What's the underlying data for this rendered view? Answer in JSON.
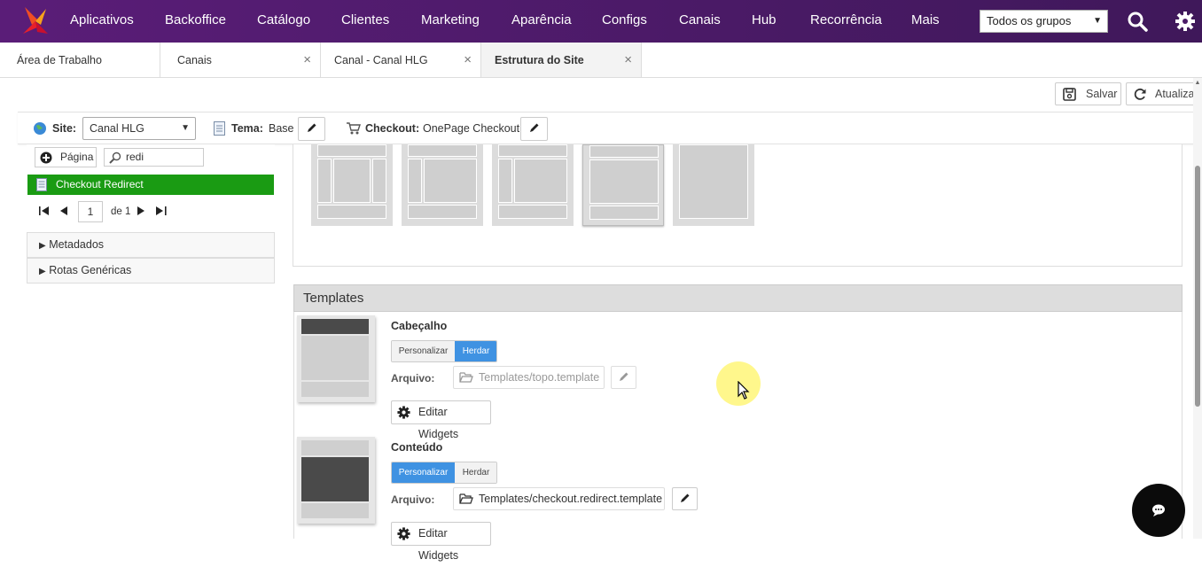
{
  "topnav": {
    "menu": [
      "Aplicativos",
      "Backoffice",
      "Catálogo",
      "Clientes",
      "Marketing",
      "Aparência",
      "Configs",
      "Canais",
      "Hub",
      "Recorrência",
      "Mais"
    ],
    "group_select": "Todos os grupos",
    "bg_color": "#4a1a66"
  },
  "tabs": [
    {
      "label": "Área de Trabalho"
    },
    {
      "label": "Canais",
      "close": "×"
    },
    {
      "label": "Canal - Canal HLG",
      "close": "×"
    },
    {
      "label": "Estrutura do Site",
      "close": "×"
    }
  ],
  "toolbar": {
    "save_label": "Salvar",
    "refresh_label": "Atualizar"
  },
  "sitebar": {
    "site_label": "Site:",
    "site_value": "Canal HLG",
    "tema_label": "Tema:",
    "tema_value": "Base",
    "checkout_label": "Checkout:",
    "checkout_value": "OnePage Checkout"
  },
  "left": {
    "add_page_label": "Página",
    "search_value": "redi",
    "result": "Checkout Redirect",
    "result_color": "#1a9b13",
    "pager": {
      "current": "1",
      "of_label": "de 1"
    },
    "sections": [
      "Metadados",
      "Rotas Genéricas"
    ]
  },
  "templates": {
    "header": "Templates",
    "file_label": "Arquivo:",
    "personalize_label": "Personalizar",
    "inherit_label": "Herdar",
    "edit_widgets_label": "Editar Widgets",
    "items": [
      {
        "name": "Cabeçalho",
        "mode": "Herdar",
        "file": "Templates/topo.template"
      },
      {
        "name": "Conteúdo",
        "mode": "Personalizar",
        "file": "Templates/checkout.redirect.template"
      }
    ],
    "accent_color": "#3f92e2"
  }
}
